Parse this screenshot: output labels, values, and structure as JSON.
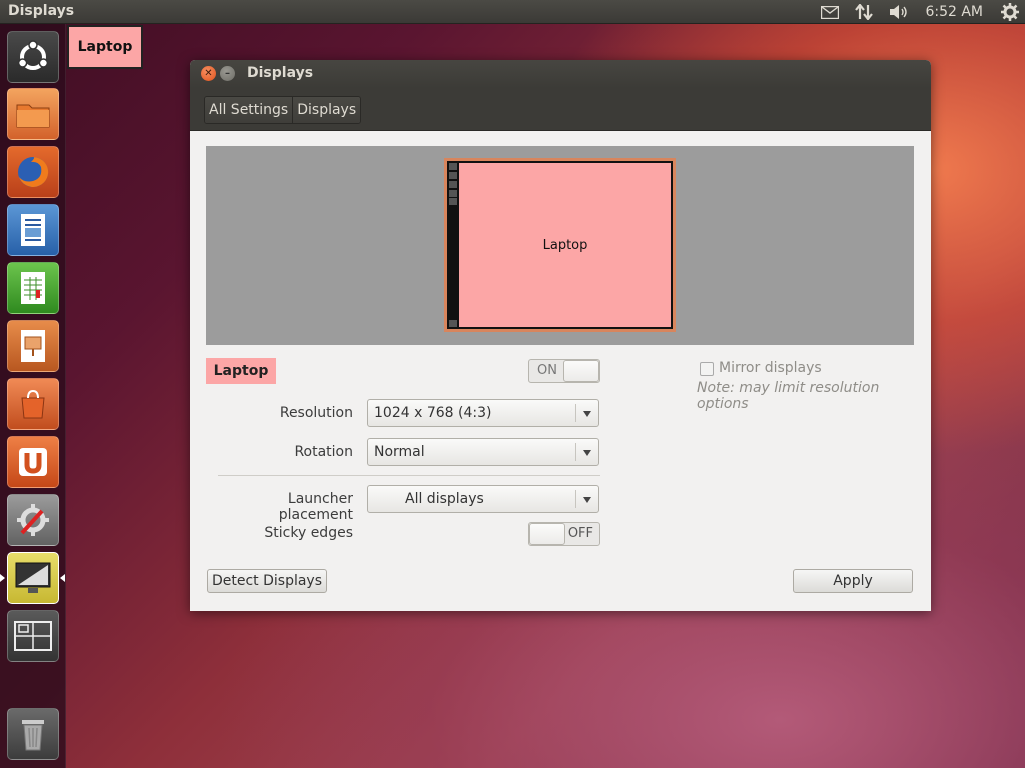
{
  "top_panel": {
    "title": "Displays",
    "clock": "6:52 AM",
    "icons": [
      "mail-icon",
      "network-icon",
      "volume-icon",
      "gear-icon"
    ]
  },
  "launcher": {
    "items": [
      {
        "name": "ubuntu-dash-icon"
      },
      {
        "name": "files-icon"
      },
      {
        "name": "firefox-icon"
      },
      {
        "name": "writer-icon"
      },
      {
        "name": "calc-icon"
      },
      {
        "name": "impress-icon"
      },
      {
        "name": "software-center-icon"
      },
      {
        "name": "ubuntu-one-icon"
      },
      {
        "name": "system-settings-icon"
      },
      {
        "name": "displays-icon"
      },
      {
        "name": "workspace-switcher-icon"
      },
      {
        "name": "trash-icon"
      }
    ]
  },
  "corner_label": "Laptop",
  "window": {
    "title": "Displays",
    "breadcrumbs": [
      "All Settings",
      "Displays"
    ],
    "preview": {
      "monitor_label": "Laptop"
    },
    "display_name": "Laptop",
    "power_switch": "ON",
    "mirror_label": "Mirror displays",
    "mirror_note": "Note: may limit resolution options",
    "resolution_label": "Resolution",
    "resolution_value": "1024 x 768 (4:3)",
    "rotation_label": "Rotation",
    "rotation_value": "Normal",
    "launcher_label": "Launcher placement",
    "launcher_value": "All displays",
    "sticky_label": "Sticky edges",
    "sticky_switch": "OFF",
    "detect_button": "Detect Displays",
    "apply_button": "Apply"
  },
  "colors": {
    "accent": "#fca6a6",
    "window_chrome": "#3c3b37",
    "close_button": "#e0521c"
  }
}
